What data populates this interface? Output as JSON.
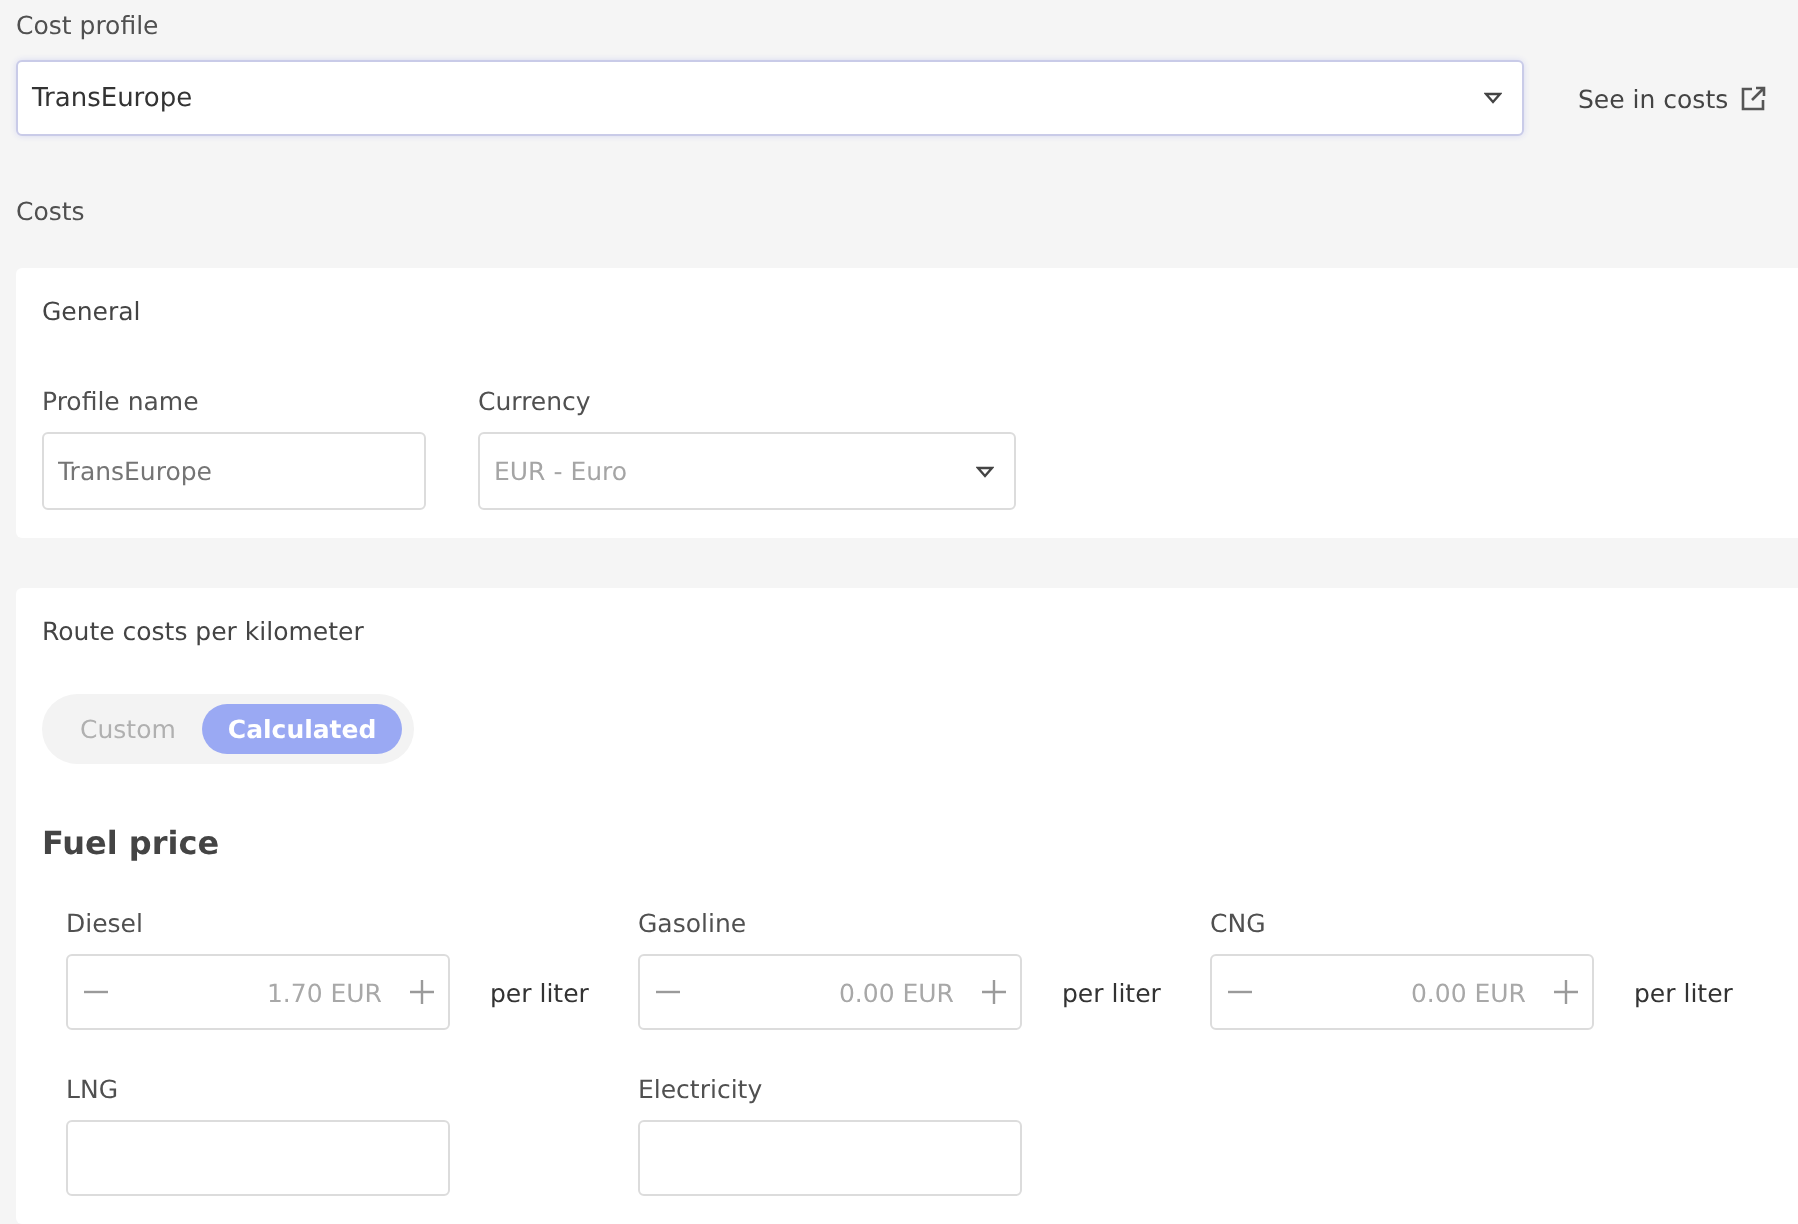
{
  "cost_profile": {
    "label": "Cost profile",
    "value": "TransEurope",
    "link": "See in costs"
  },
  "costs_heading": "Costs",
  "general": {
    "title": "General",
    "fields": [
      {
        "kind": "text",
        "label": "Profile name",
        "placeholder": "TransEurope"
      },
      {
        "kind": "select",
        "label": "Currency",
        "placeholder": "EUR - Euro"
      }
    ]
  },
  "route_costs": {
    "title": "Route costs per kilometer",
    "modes": [
      {
        "label": "Custom",
        "selected": false
      },
      {
        "label": "Calculated",
        "selected": true
      }
    ],
    "fuel_title": "Fuel price",
    "fuels": [
      {
        "label": "Diesel",
        "value": "1.70 EUR",
        "unit": "per liter"
      },
      {
        "label": "Gasoline",
        "value": "0.00 EUR",
        "unit": "per liter"
      },
      {
        "label": "CNG",
        "value": "0.00 EUR",
        "unit": "per liter"
      },
      {
        "label": "LNG"
      },
      {
        "label": "Electricity"
      }
    ]
  }
}
